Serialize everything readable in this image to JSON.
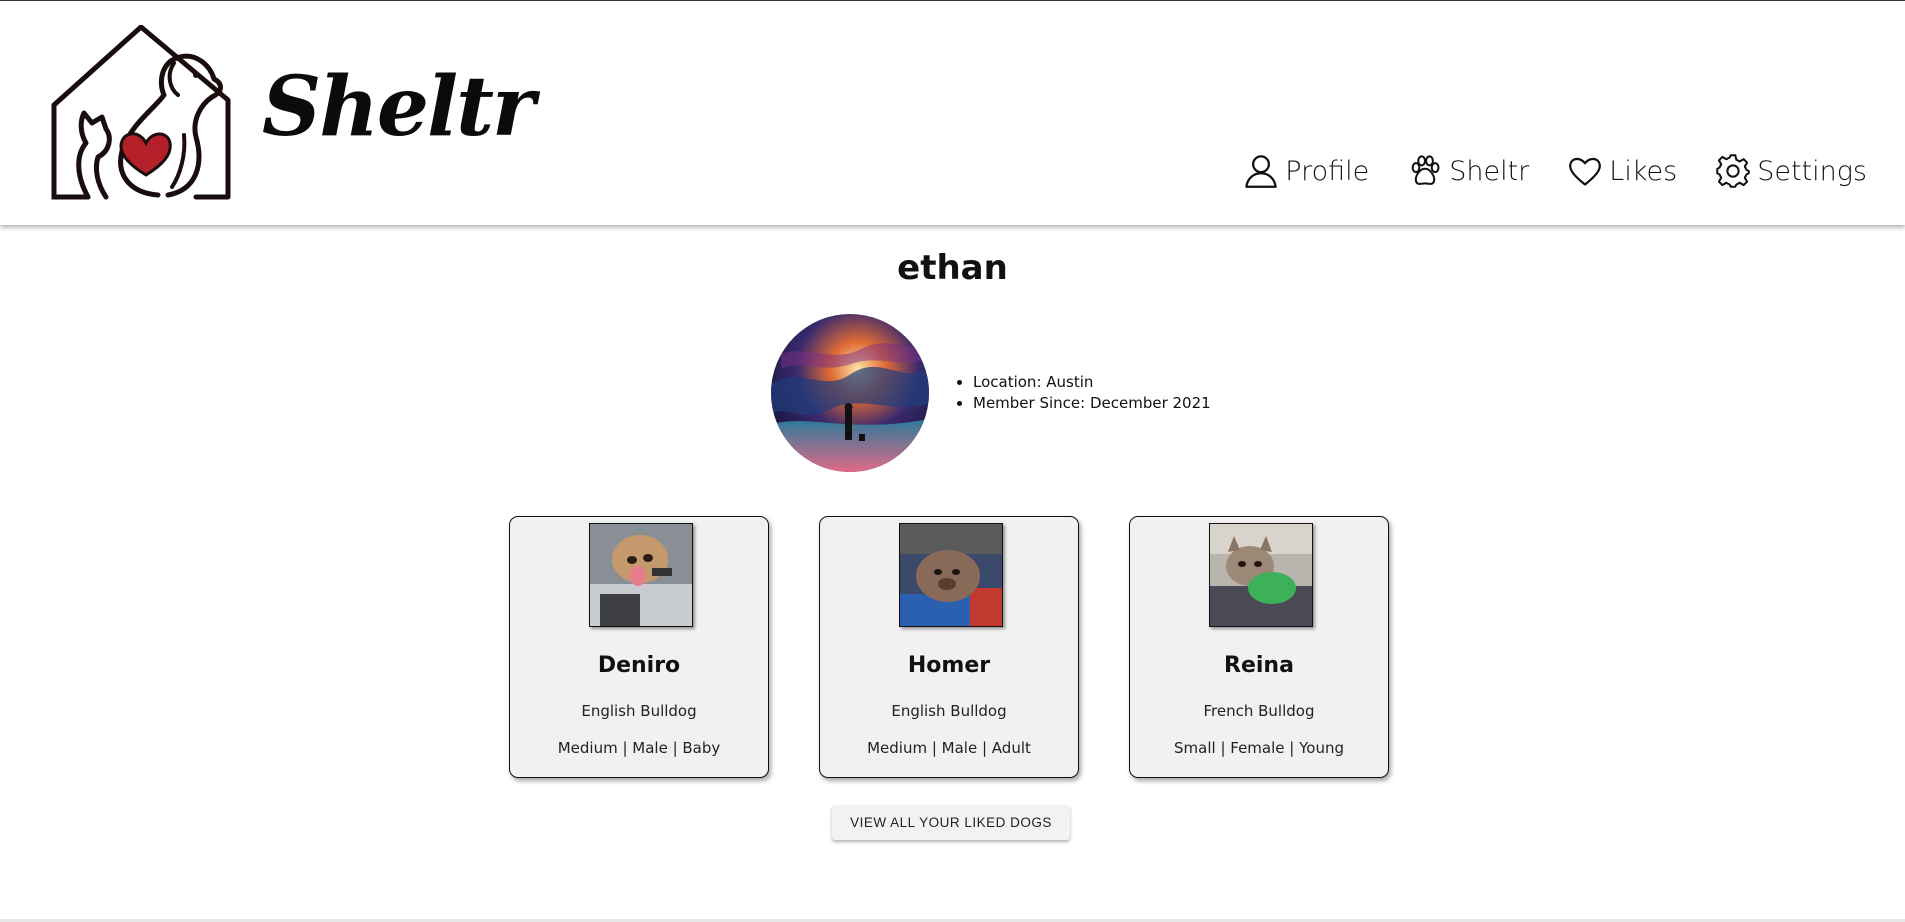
{
  "header": {
    "brand": "Sheltr",
    "nav": [
      {
        "label": "Profile",
        "icon": "user-icon"
      },
      {
        "label": "Sheltr",
        "icon": "paw-icon"
      },
      {
        "label": "Likes",
        "icon": "heart-icon"
      },
      {
        "label": "Settings",
        "icon": "gear-icon"
      }
    ]
  },
  "profile": {
    "username": "ethan",
    "location": "Location: Austin",
    "member_since": "Member Since: December 2021"
  },
  "liked_dogs": [
    {
      "name": "Deniro",
      "breed": "English Bulldog",
      "details": "Medium | Male | Baby"
    },
    {
      "name": "Homer",
      "breed": "English Bulldog",
      "details": "Medium | Male | Adult"
    },
    {
      "name": "Reina",
      "breed": "French Bulldog",
      "details": "Small | Female | Young"
    }
  ],
  "view_all_label": "VIEW ALL YOUR LIKED DOGS",
  "colors": {
    "heart_accent": "#b3202a",
    "card_bg": "#f1f1f1"
  }
}
